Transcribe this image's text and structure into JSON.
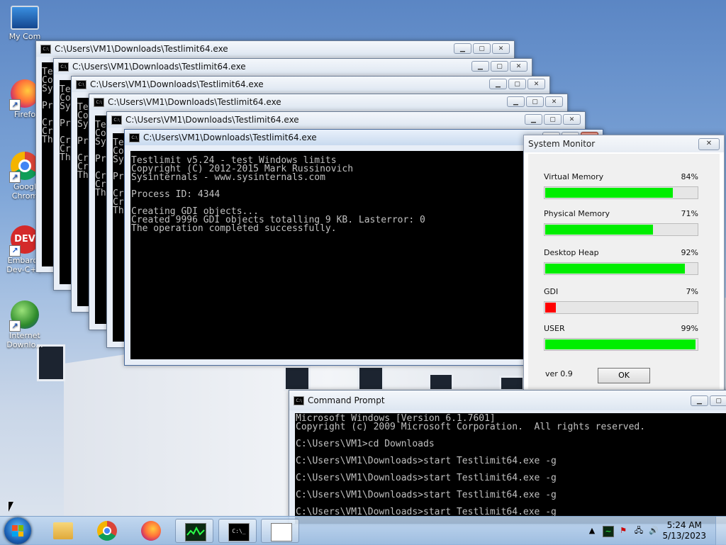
{
  "desktop": {
    "icons": [
      {
        "name": "my-computer",
        "label1": "My Com",
        "label2": ""
      },
      {
        "name": "firefox",
        "label1": "Firefo",
        "label2": ""
      },
      {
        "name": "google-chrome",
        "label1": "Googl",
        "label2": "Chrom"
      },
      {
        "name": "embarcadero-dev-cpp",
        "label1": "Embarca",
        "label2": "Dev-C++"
      },
      {
        "name": "internet-download-manager",
        "label1": "Internet",
        "label2": "Downlo..."
      }
    ]
  },
  "testlimit_windows": {
    "title": "C:\\Users\\VM1\\Downloads\\Testlimit64.exe",
    "partial_lines": [
      "Te",
      "Co",
      "Sy",
      "",
      "Pr",
      "",
      "Cr",
      "Cr",
      "Th"
    ],
    "main_console_lines": [
      "Testlimit v5.24 - test Windows limits",
      "Copyright (C) 2012-2015 Mark Russinovich",
      "Sysinternals - www.sysinternals.com",
      "",
      "Process ID: 4344",
      "",
      "Creating GDI objects...",
      "Created 9996 GDI objects totalling 9 KB. Lasterror: 0",
      "The operation completed successfully."
    ]
  },
  "system_monitor": {
    "title": "System Monitor",
    "meters": [
      {
        "label": "Virtual Memory",
        "percent_text": "84%",
        "value": 84,
        "color": "#00ee00"
      },
      {
        "label": "Physical Memory",
        "percent_text": "71%",
        "value": 71,
        "color": "#00ee00"
      },
      {
        "label": "Desktop Heap",
        "percent_text": "92%",
        "value": 92,
        "color": "#00ee00"
      },
      {
        "label": "GDI",
        "percent_text": "7%",
        "value": 7,
        "color": "#ff0000"
      },
      {
        "label": "USER",
        "percent_text": "99%",
        "value": 99,
        "color": "#00ee00"
      }
    ],
    "version": "ver 0.9",
    "ok_label": "OK"
  },
  "command_prompt": {
    "title": "Command Prompt",
    "lines": [
      "Microsoft Windows [Version 6.1.7601]",
      "Copyright (c) 2009 Microsoft Corporation.  All rights reserved.",
      "",
      "C:\\Users\\VM1>cd Downloads",
      "",
      "C:\\Users\\VM1\\Downloads>start Testlimit64.exe -g",
      "",
      "C:\\Users\\VM1\\Downloads>start Testlimit64.exe -g",
      "",
      "C:\\Users\\VM1\\Downloads>start Testlimit64.exe -g",
      "",
      "C:\\Users\\VM1\\Downloads>start Testlimit64.exe -g"
    ]
  },
  "taskbar": {
    "items": [
      "windows-explorer",
      "google-chrome",
      "firefox",
      "system-monitor",
      "command-prompt",
      "testlimit"
    ],
    "clock_time": "5:24 AM",
    "clock_date": "5/13/2023"
  },
  "colors": {
    "bar_green": "#00ee00",
    "bar_red": "#ff0000",
    "console_bg": "#000000",
    "console_text": "#c0c0c0"
  }
}
